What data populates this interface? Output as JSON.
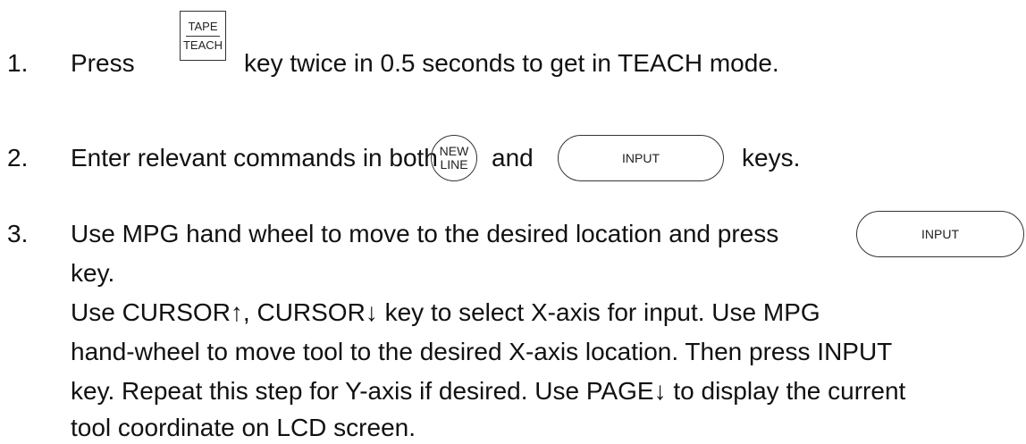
{
  "steps": [
    {
      "number": "1.",
      "before": "Press",
      "key_top": "TAPE",
      "key_bottom": "TEACH",
      "after": "key twice in 0.5 seconds to get in TEACH mode."
    },
    {
      "number": "2.",
      "before": "Enter relevant commands in both",
      "key1_top": "NEW",
      "key1_bottom": "LINE",
      "middle": "and",
      "key2": "INPUT",
      "after": "keys."
    },
    {
      "number": "3.",
      "line1": "Use MPG hand wheel to move to the desired location and press",
      "key": "INPUT",
      "line2": "key.",
      "lines": [
        "Use CURSOR↑, CURSOR↓ key to select X-axis for input. Use MPG",
        "hand-wheel to move tool to the desired X-axis location. Then press INPUT",
        "key. Repeat this step for Y-axis if desired. Use PAGE↓ to display the current",
        "tool coordinate on LCD screen."
      ]
    }
  ]
}
